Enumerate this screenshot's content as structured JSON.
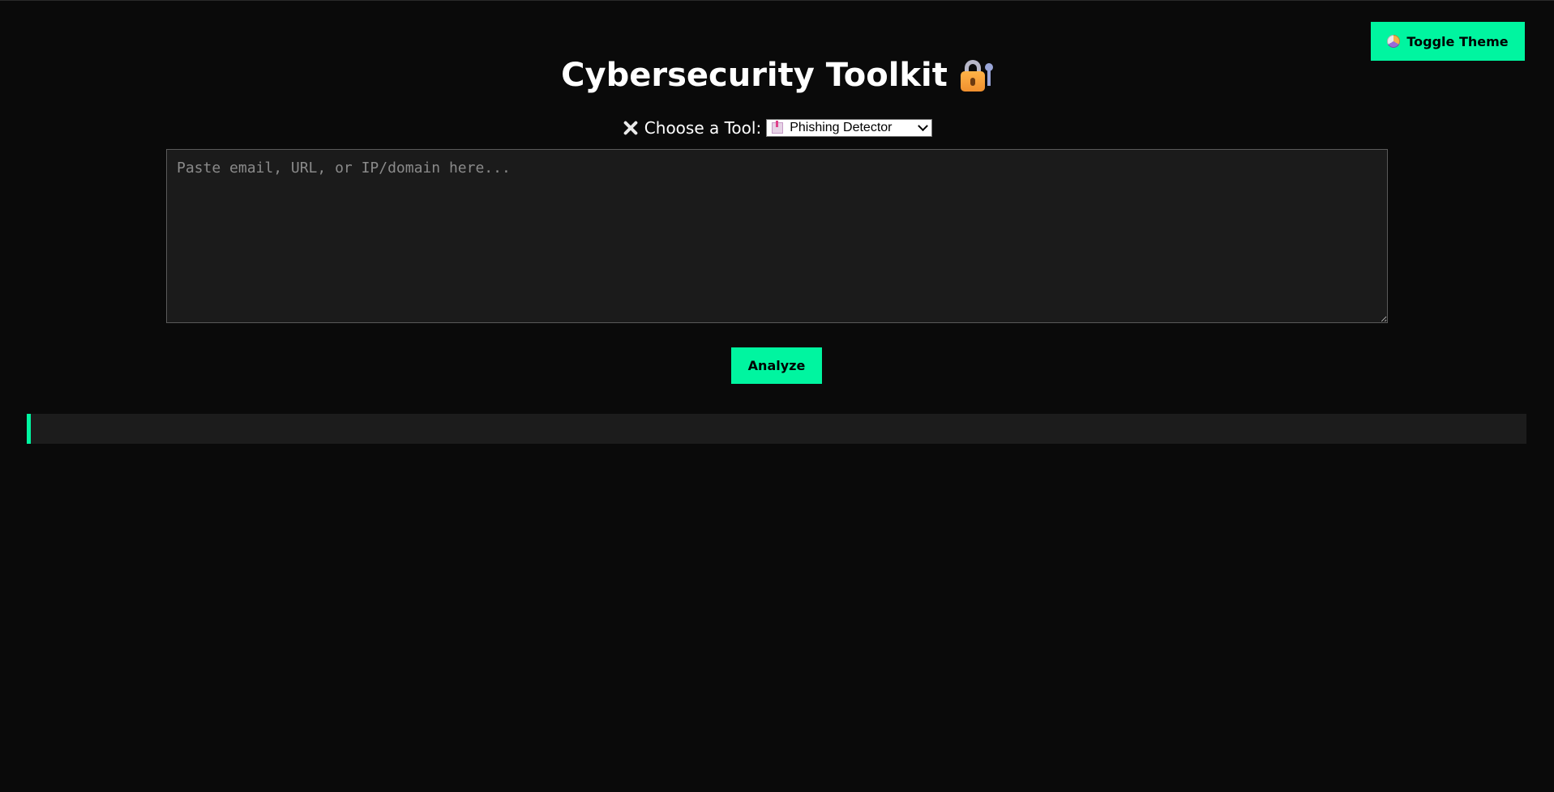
{
  "header": {
    "title": "Cybersecurity Toolkit",
    "title_icon": "lock-with-key-icon"
  },
  "theme_toggle": {
    "label": "Toggle Theme",
    "icon": "theme-circle-icon"
  },
  "tool_selector": {
    "label": "Choose a Tool:",
    "label_icon": "tools-icon",
    "selected": "Phishing Detector",
    "selected_icon": "inbox-icon"
  },
  "input": {
    "placeholder": "Paste email, URL, or IP/domain here...",
    "value": ""
  },
  "actions": {
    "analyze_label": "Analyze"
  },
  "output": {
    "text": ""
  },
  "colors": {
    "accent": "#00f5a0",
    "background": "#0a0a0a",
    "panel": "#1b1b1b"
  }
}
